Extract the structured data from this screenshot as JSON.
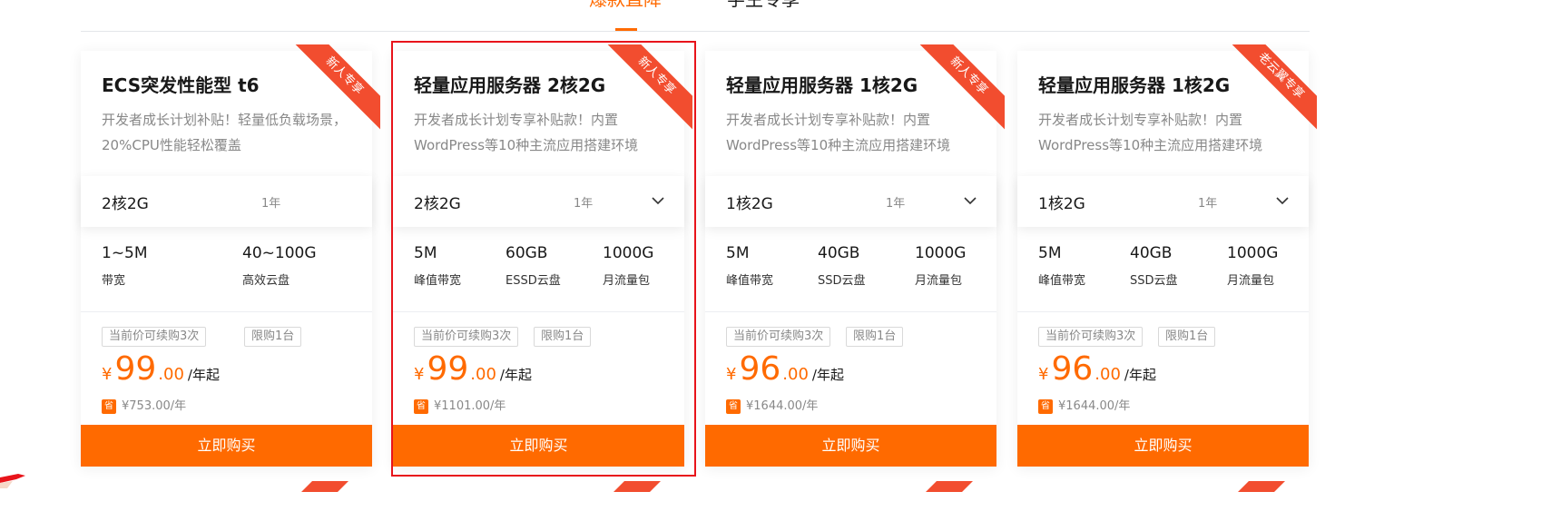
{
  "tabs": [
    {
      "label": "爆款直降",
      "active": true
    },
    {
      "label": "学生专享",
      "active": false
    }
  ],
  "cards": [
    {
      "ribbon": "新人专享",
      "title": "ECS突发性能型 t6",
      "desc": "开发者成长计划补贴！轻量低负载场景，20%CPU性能轻松覆盖",
      "spec": "2核2G",
      "term": "1年",
      "has_dropdown": false,
      "stats": [
        {
          "value": "1~5M",
          "label": "带宽"
        },
        {
          "value": "40~100G",
          "label": "高效云盘"
        }
      ],
      "tags": [
        "当前价可续购3次",
        "限购1台"
      ],
      "price": {
        "currency": "¥",
        "integer": "99",
        "decimal": ".00",
        "unit": "/年起"
      },
      "save_icon": "省",
      "save_text": "¥753.00/年",
      "buy": "立即购买"
    },
    {
      "ribbon": "新人专享",
      "title": "轻量应用服务器 2核2G",
      "desc": "开发者成长计划专享补贴款！内置WordPress等10种主流应用搭建环境",
      "spec": "2核2G",
      "term": "1年",
      "has_dropdown": true,
      "stats": [
        {
          "value": "5M",
          "label": "峰值带宽"
        },
        {
          "value": "60GB",
          "label": "ESSD云盘"
        },
        {
          "value": "1000G",
          "label": "月流量包"
        }
      ],
      "tags": [
        "当前价可续购3次",
        "限购1台"
      ],
      "price": {
        "currency": "¥",
        "integer": "99",
        "decimal": ".00",
        "unit": "/年起"
      },
      "save_icon": "省",
      "save_text": "¥1101.00/年",
      "buy": "立即购买"
    },
    {
      "ribbon": "新人专享",
      "title": "轻量应用服务器 1核2G",
      "desc": "开发者成长计划专享补贴款！内置WordPress等10种主流应用搭建环境",
      "spec": "1核2G",
      "term": "1年",
      "has_dropdown": true,
      "stats": [
        {
          "value": "5M",
          "label": "峰值带宽"
        },
        {
          "value": "40GB",
          "label": "SSD云盘"
        },
        {
          "value": "1000G",
          "label": "月流量包"
        }
      ],
      "tags": [
        "当前价可续购3次",
        "限购1台"
      ],
      "price": {
        "currency": "¥",
        "integer": "96",
        "decimal": ".00",
        "unit": "/年起"
      },
      "save_icon": "省",
      "save_text": "¥1644.00/年",
      "buy": "立即购买"
    },
    {
      "ribbon": "老云翼专享",
      "title": "轻量应用服务器 1核2G",
      "desc": "开发者成长计划专享补贴款！内置WordPress等10种主流应用搭建环境",
      "spec": "1核2G",
      "term": "1年",
      "has_dropdown": true,
      "stats": [
        {
          "value": "5M",
          "label": "峰值带宽"
        },
        {
          "value": "40GB",
          "label": "SSD云盘"
        },
        {
          "value": "1000G",
          "label": "月流量包"
        }
      ],
      "tags": [
        "当前价可续购3次",
        "限购1台"
      ],
      "price": {
        "currency": "¥",
        "integer": "96",
        "decimal": ".00",
        "unit": "/年起"
      },
      "save_icon": "省",
      "save_text": "¥1644.00/年",
      "buy": "立即购买"
    }
  ],
  "colors": {
    "accent": "#ff6a00",
    "ribbon": "#f24d2f",
    "highlight_border": "#e8141b"
  },
  "icons": {
    "dropdown": "chevron-down-icon",
    "save": "save-badge-icon"
  }
}
